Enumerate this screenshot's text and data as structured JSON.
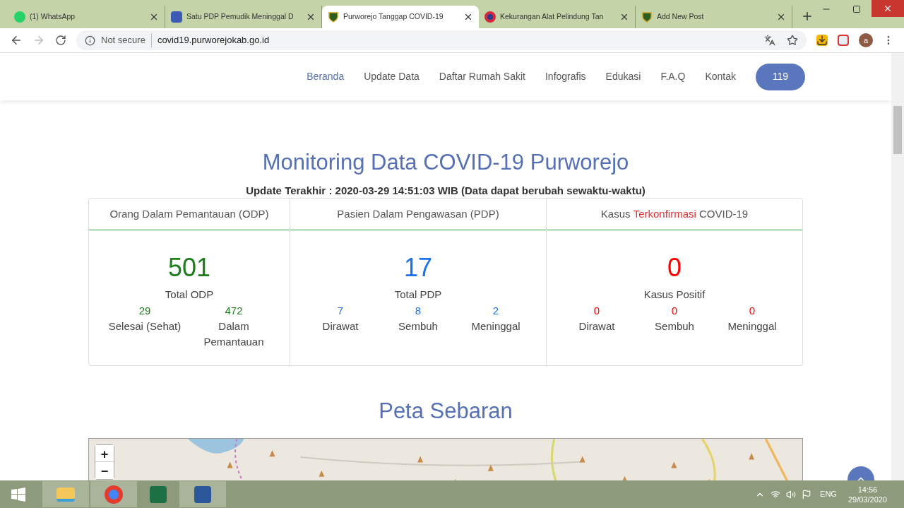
{
  "browser": {
    "tabs": [
      {
        "title": "(1) WhatsApp",
        "selected": false
      },
      {
        "title": "Satu PDP Pemudik Meninggal D",
        "selected": false
      },
      {
        "title": "Purworejo Tanggap COVID-19",
        "selected": true
      },
      {
        "title": "Kekurangan Alat Pelindung Tan",
        "selected": false
      },
      {
        "title": "Add New Post",
        "selected": false
      }
    ],
    "security": "Not secure",
    "url": "covid19.purworejokab.go.id",
    "profile": "a"
  },
  "nav": {
    "items": [
      {
        "label": "Beranda",
        "selected": true
      },
      {
        "label": "Update Data",
        "selected": false
      },
      {
        "label": "Daftar Rumah Sakit",
        "selected": false
      },
      {
        "label": "Infografis",
        "selected": false
      },
      {
        "label": "Edukasi",
        "selected": false
      },
      {
        "label": "F.A.Q",
        "selected": false
      },
      {
        "label": "Kontak",
        "selected": false
      }
    ],
    "hotline": "119"
  },
  "heading": "Monitoring Data COVID-19 Purworejo",
  "update": "Update Terakhir : 2020-03-29 14:51:03 WIB (Data dapat berubah sewaktu-waktu)",
  "cards": [
    {
      "title": "Orang Dalam Pemantauan (ODP)",
      "color": "#1e7e1e",
      "total": "501",
      "total_label": "Total ODP",
      "stats": [
        {
          "value": "29",
          "label": "Selesai (Sehat)"
        },
        {
          "value": "472",
          "label": "Dalam Pemantauan"
        }
      ]
    },
    {
      "title": "Pasien Dalam Pengawasan (PDP)",
      "color": "#1a73e8",
      "total": "17",
      "total_label": "Total PDP",
      "stats": [
        {
          "value": "7",
          "label": "Dirawat"
        },
        {
          "value": "8",
          "label": "Sembuh"
        },
        {
          "value": "2",
          "label": "Meninggal"
        }
      ]
    },
    {
      "title": "Kasus",
      "title_highlight": "Terkonfirmasi",
      "title_end": "COVID-19",
      "color": "#ff0000",
      "total": "0",
      "total_label": "Kasus Positif",
      "stats": [
        {
          "value": "0",
          "label": "Dirawat"
        },
        {
          "value": "0",
          "label": "Sembuh"
        },
        {
          "value": "0",
          "label": "Meninggal"
        }
      ]
    }
  ],
  "map": {
    "title": "Peta Sebaran",
    "zoom_in": "+",
    "zoom_out": "−"
  },
  "taskbar": {
    "language": "ENG",
    "time": "14:56",
    "date": "29/03/2020"
  }
}
